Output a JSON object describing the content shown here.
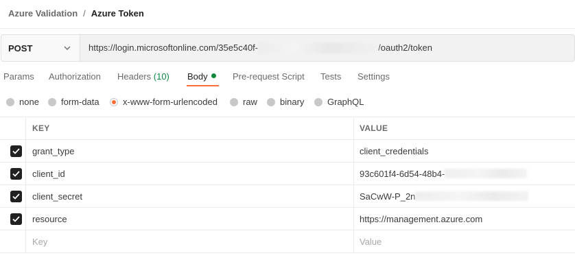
{
  "breadcrumb": {
    "parent": "Azure Validation",
    "separator": "/",
    "current": "Azure Token"
  },
  "request": {
    "method": "POST",
    "url_prefix": "https://login.microsoftonline.com/35e5c40f-",
    "url_suffix": "/oauth2/token"
  },
  "tabs": [
    {
      "label": "Params"
    },
    {
      "label": "Authorization"
    },
    {
      "label": "Headers",
      "count": "(10)"
    },
    {
      "label": "Body",
      "active": true
    },
    {
      "label": "Pre-request Script"
    },
    {
      "label": "Tests"
    },
    {
      "label": "Settings"
    }
  ],
  "body_types": [
    {
      "label": "none",
      "selected": false
    },
    {
      "label": "form-data",
      "selected": false
    },
    {
      "label": "x-www-form-urlencoded",
      "selected": true
    },
    {
      "label": "raw",
      "selected": false
    },
    {
      "label": "binary",
      "selected": false
    },
    {
      "label": "GraphQL",
      "selected": false
    }
  ],
  "table": {
    "headers": {
      "key": "KEY",
      "value": "VALUE"
    },
    "rows": [
      {
        "key": "grant_type",
        "value": "client_credentials",
        "checked": true
      },
      {
        "key": "client_id",
        "value": "93c601f4-6d54-48b4-",
        "checked": true
      },
      {
        "key": "client_secret",
        "value": "SaCwW-P_2n",
        "checked": true
      },
      {
        "key": "resource",
        "value": "https://management.azure.com",
        "checked": true
      }
    ],
    "new_row": {
      "key_placeholder": "Key",
      "value_placeholder": "Value"
    }
  },
  "colors": {
    "accent": "#ff6c37",
    "success_dot": "#0f8a3c",
    "headers_count": "#0b8a3e",
    "checkbox": "#212121"
  },
  "icons": {
    "method_dropdown": "chevron-down-icon",
    "checkbox": "check-icon"
  }
}
